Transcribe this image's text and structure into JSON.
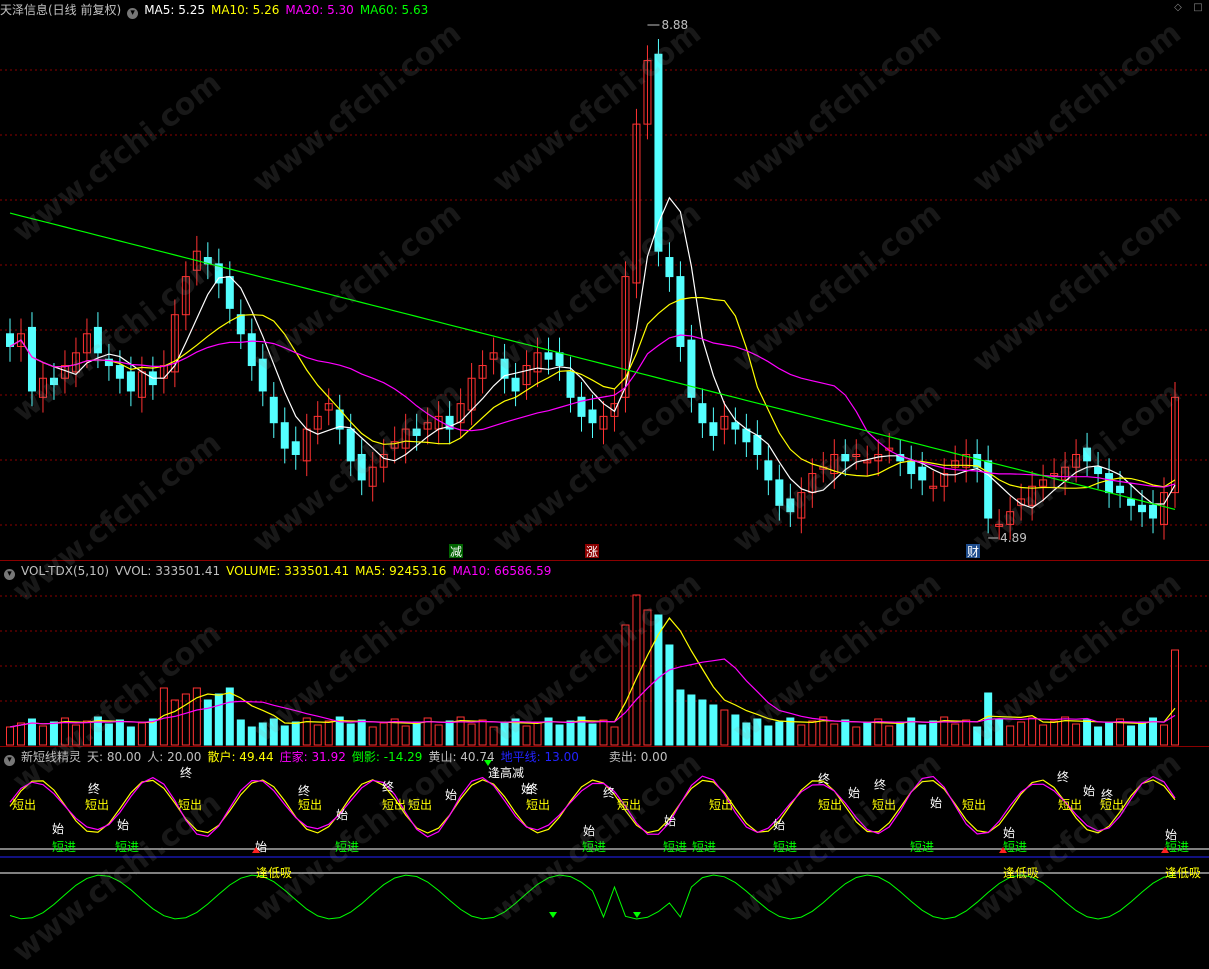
{
  "price_panel": {
    "title": "天泽信息(日线 前复权)",
    "ma_labels": [
      {
        "text": "MA5: 5.25",
        "color": "#ffffff"
      },
      {
        "text": "MA10: 5.26",
        "color": "#ffff00"
      },
      {
        "text": "MA20: 5.30",
        "color": "#ff00ff"
      },
      {
        "text": "MA60: 5.63",
        "color": "#00ff00"
      }
    ],
    "high_label": "8.88",
    "low_label": "4.89",
    "markers": [
      {
        "text": "减",
        "color": "#ffffff",
        "bg": "#006400"
      },
      {
        "text": "涨",
        "color": "#ffffff",
        "bg": "#8b0000"
      },
      {
        "text": "财",
        "color": "#ffffff",
        "bg": "#1e4c8c"
      }
    ]
  },
  "volume_panel": {
    "labels": [
      {
        "text": "VOL-TDX(5,10)",
        "color": "#c0c0c0"
      },
      {
        "text": "VVOL: 333501.41",
        "color": "#c0c0c0"
      },
      {
        "text": "VOLUME: 333501.41",
        "color": "#ffff00"
      },
      {
        "text": "MA5: 92453.16",
        "color": "#ffff00"
      },
      {
        "text": "MA10: 66586.59",
        "color": "#ff00ff"
      }
    ]
  },
  "indicator_panel": {
    "labels": [
      {
        "text": "新短线精灵",
        "color": "#c0c0c0"
      },
      {
        "text": "天: 80.00",
        "color": "#c0c0c0"
      },
      {
        "text": "人: 20.00",
        "color": "#c0c0c0"
      },
      {
        "text": "散户: 49.44",
        "color": "#ffff00"
      },
      {
        "text": "庄家: 31.92",
        "color": "#ff00ff"
      },
      {
        "text": "倒影: -14.29",
        "color": "#00ff00"
      },
      {
        "text": "黄山: 40.74",
        "color": "#c0c0c0"
      },
      {
        "text": "地平线: 13.00",
        "color": "#2222ff"
      },
      {
        "text": "卖出: 0.00",
        "color": "#c0c0c0"
      }
    ],
    "tags": [
      {
        "text": "短出",
        "color": "#ffff00"
      },
      {
        "text": "短进",
        "color": "#00ff00"
      },
      {
        "text": "始",
        "color": "#ffffff"
      },
      {
        "text": "终",
        "color": "#ffffff"
      },
      {
        "text": "逢高减",
        "color": "#ffffff"
      },
      {
        "text": "逢低吸",
        "color": "#ffff00"
      }
    ]
  },
  "watermark": "www.cfchi.com",
  "colors": {
    "up": "#ff3232",
    "down": "#54ffff",
    "ma5": "#ffffff",
    "ma10": "#ffff00",
    "ma20": "#ff00ff",
    "ma60": "#00ff00",
    "grid": "#8b0000"
  }
}
